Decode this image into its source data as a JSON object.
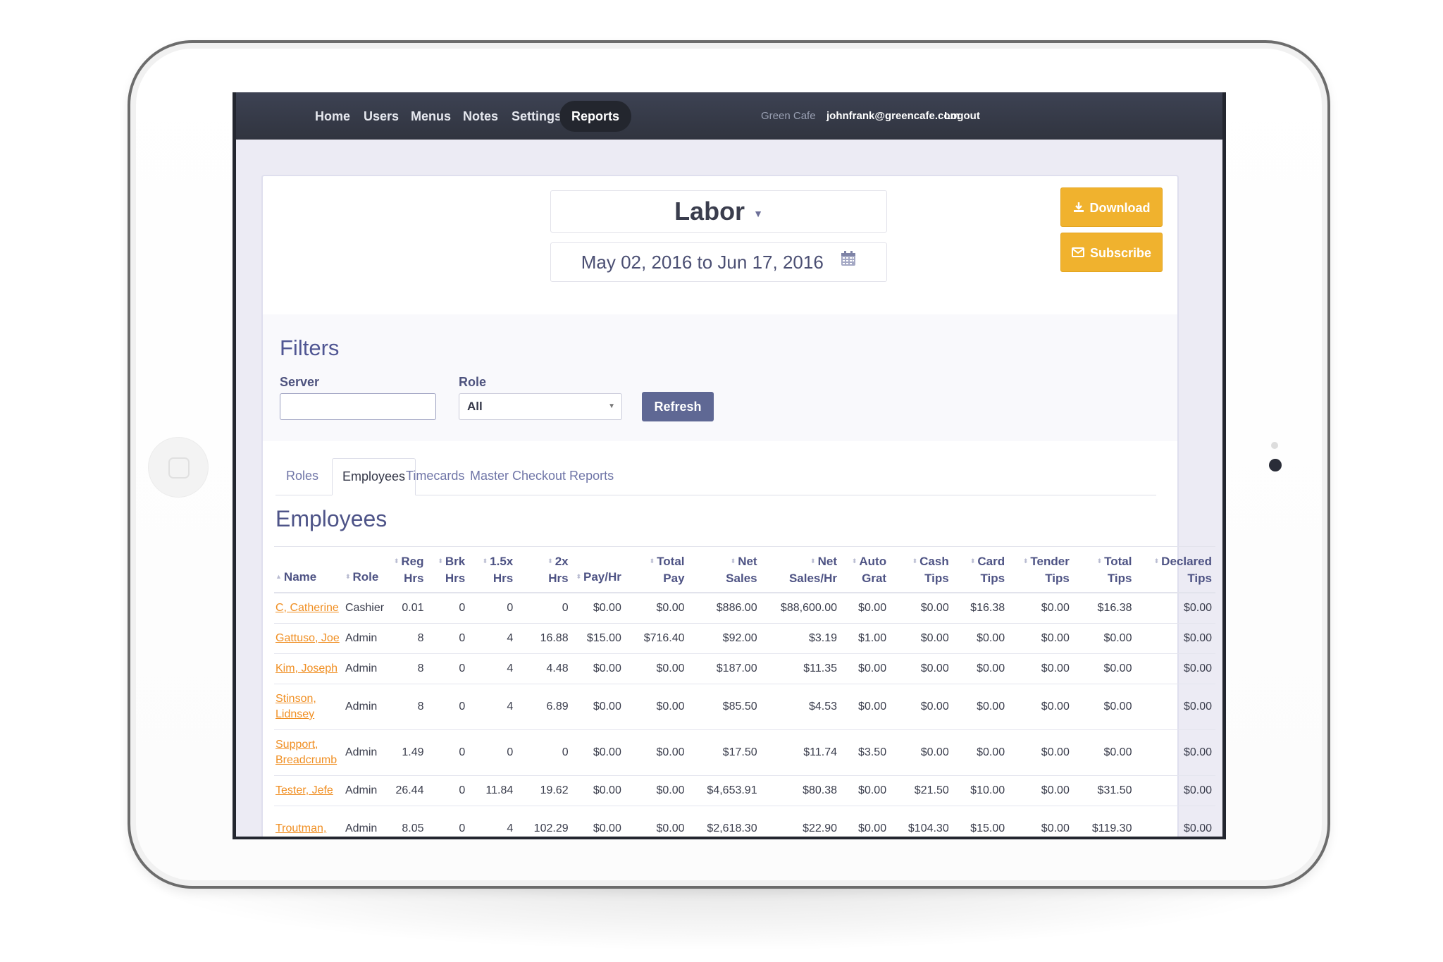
{
  "nav": {
    "items": [
      {
        "label": "Home",
        "active": false
      },
      {
        "label": "Users",
        "active": false
      },
      {
        "label": "Menus",
        "active": false
      },
      {
        "label": "Notes",
        "active": false
      },
      {
        "label": "Settings",
        "active": false
      },
      {
        "label": "Reports",
        "active": true
      }
    ],
    "org": "Green Cafe",
    "email": "johnfrank@greencafe.com",
    "logout": "Logout"
  },
  "report": {
    "title": "Labor",
    "caret": "▼",
    "date_range": "May 02, 2016 to Jun 17, 2016",
    "download_label": "Download",
    "subscribe_label": "Subscribe"
  },
  "filters": {
    "title": "Filters",
    "server_label": "Server",
    "server_value": "",
    "role_label": "Role",
    "role_value": "All",
    "refresh_label": "Refresh"
  },
  "tabs": [
    {
      "label": "Roles",
      "active": false
    },
    {
      "label": "Employees",
      "active": true
    },
    {
      "label": "Timecards",
      "active": false
    },
    {
      "label": "Master Checkout Reports",
      "active": false
    }
  ],
  "section_title": "Employees",
  "table": {
    "columns": [
      {
        "l1": "",
        "l2": "Name",
        "sort": "▲"
      },
      {
        "l1": "",
        "l2": "Role",
        "sort": "⬍"
      },
      {
        "l1": "Reg",
        "l2": "Hrs",
        "sort": "⬍"
      },
      {
        "l1": "Brk",
        "l2": "Hrs",
        "sort": "⬍"
      },
      {
        "l1": "1.5x",
        "l2": "Hrs",
        "sort": "⬍"
      },
      {
        "l1": "2x",
        "l2": "Hrs",
        "sort": "⬍"
      },
      {
        "l1": "",
        "l2": "Pay/Hr",
        "sort": "⬍"
      },
      {
        "l1": "Total",
        "l2": "Pay",
        "sort": "⬍"
      },
      {
        "l1": "Net",
        "l2": "Sales",
        "sort": "⬍"
      },
      {
        "l1": "Net",
        "l2": "Sales/Hr",
        "sort": "⬍"
      },
      {
        "l1": "Auto",
        "l2": "Grat",
        "sort": "⬍"
      },
      {
        "l1": "Cash",
        "l2": "Tips",
        "sort": "⬍"
      },
      {
        "l1": "Card",
        "l2": "Tips",
        "sort": "⬍"
      },
      {
        "l1": "Tender",
        "l2": "Tips",
        "sort": "⬍"
      },
      {
        "l1": "Total",
        "l2": "Tips",
        "sort": "⬍"
      },
      {
        "l1": "Declared",
        "l2": "Tips",
        "sort": "⬍"
      }
    ],
    "rows": [
      {
        "name": "C, Catherine",
        "tall": false,
        "cells": [
          "Cashier",
          "0.01",
          "0",
          "0",
          "0",
          "$0.00",
          "$0.00",
          "$886.00",
          "$88,600.00",
          "$0.00",
          "$0.00",
          "$16.38",
          "$0.00",
          "$16.38",
          "$0.00"
        ]
      },
      {
        "name": "Gattuso, Joe",
        "tall": false,
        "cells": [
          "Admin",
          "8",
          "0",
          "4",
          "16.88",
          "$15.00",
          "$716.40",
          "$92.00",
          "$3.19",
          "$1.00",
          "$0.00",
          "$0.00",
          "$0.00",
          "$0.00",
          "$0.00"
        ]
      },
      {
        "name": "Kim, Joseph",
        "tall": false,
        "cells": [
          "Admin",
          "8",
          "0",
          "4",
          "4.48",
          "$0.00",
          "$0.00",
          "$187.00",
          "$11.35",
          "$0.00",
          "$0.00",
          "$0.00",
          "$0.00",
          "$0.00",
          "$0.00"
        ]
      },
      {
        "name": "Stinson, Lidnsey",
        "tall": true,
        "cells": [
          "Admin",
          "8",
          "0",
          "4",
          "6.89",
          "$0.00",
          "$0.00",
          "$85.50",
          "$4.53",
          "$0.00",
          "$0.00",
          "$0.00",
          "$0.00",
          "$0.00",
          "$0.00"
        ]
      },
      {
        "name": "Support, Breadcrumb",
        "tall": true,
        "cells": [
          "Admin",
          "1.49",
          "0",
          "0",
          "0",
          "$0.00",
          "$0.00",
          "$17.50",
          "$11.74",
          "$3.50",
          "$0.00",
          "$0.00",
          "$0.00",
          "$0.00",
          "$0.00"
        ]
      },
      {
        "name": "Tester, Jefe",
        "tall": false,
        "cells": [
          "Admin",
          "26.44",
          "0",
          "11.84",
          "19.62",
          "$0.00",
          "$0.00",
          "$4,653.91",
          "$80.38",
          "$0.00",
          "$21.50",
          "$10.00",
          "$0.00",
          "$31.50",
          "$0.00"
        ]
      },
      {
        "name": "Troutman,",
        "tall": true,
        "cells": [
          "Admin",
          "8.05",
          "0",
          "4",
          "102.29",
          "$0.00",
          "$0.00",
          "$2,618.30",
          "$22.90",
          "$0.00",
          "$104.30",
          "$15.00",
          "$0.00",
          "$119.30",
          "$0.00"
        ]
      }
    ]
  },
  "colors": {
    "nav_bg": "#30343f",
    "accent_orange": "#f0b22e",
    "refresh_bg": "#5f6894",
    "link_orange": "#f08f23",
    "screen_bg": "#ecebf4"
  }
}
